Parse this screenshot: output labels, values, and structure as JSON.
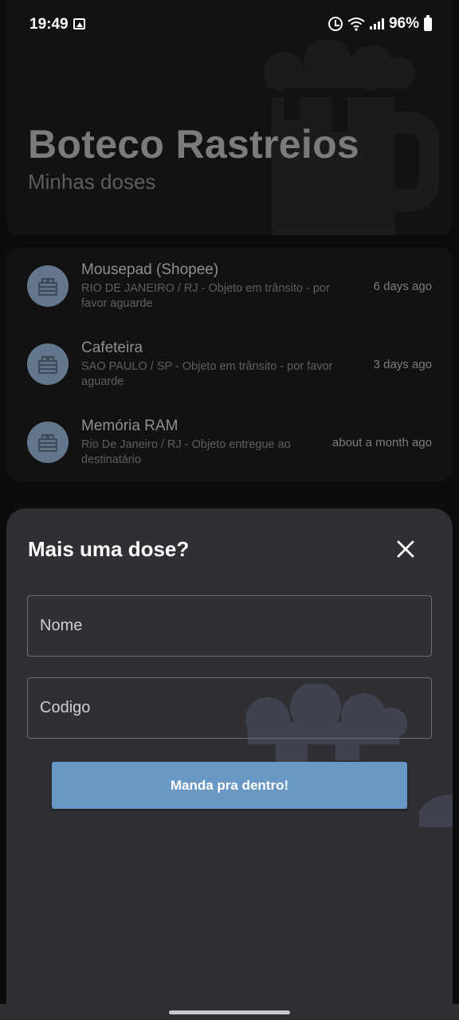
{
  "status_bar": {
    "time": "19:49",
    "battery": "96%",
    "icons": [
      "gallery-icon",
      "alarm-icon",
      "wifi-icon",
      "signal-icon",
      "battery-icon"
    ]
  },
  "header": {
    "title": "Boteco Rastreios",
    "subtitle": "Minhas doses",
    "background_icon": "beer-mug-icon"
  },
  "packages": [
    {
      "name": "Mousepad (Shopee)",
      "status": "RIO DE JANEIRO / RJ - Objeto em trânsito - por favor aguarde",
      "time": "6 days ago",
      "icon": "package-icon"
    },
    {
      "name": "Cafeteira",
      "status": "SAO PAULO / SP - Objeto em trânsito - por favor aguarde",
      "time": "3 days ago",
      "icon": "package-icon"
    },
    {
      "name": "Memória RAM",
      "status": "Rio De Janeiro / RJ - Objeto entregue ao destinatário",
      "time": "about a month ago",
      "icon": "package-icon"
    }
  ],
  "sheet": {
    "title": "Mais uma dose?",
    "close_icon": "close-icon",
    "name_placeholder": "Nome",
    "name_value": "",
    "code_placeholder": "Codigo",
    "code_value": "",
    "submit_label": "Manda pra dentro!"
  },
  "colors": {
    "background": "#0c0c0d",
    "card": "#121213",
    "sheet": "#303034",
    "accent": "#6a98c4",
    "avatar": "#64768c"
  }
}
